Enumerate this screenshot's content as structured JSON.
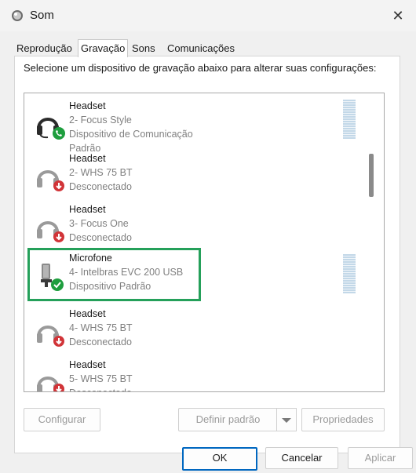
{
  "window": {
    "title": "Som"
  },
  "tabs": [
    {
      "label": "Reprodução"
    },
    {
      "label": "Gravação",
      "active": true
    },
    {
      "label": "Sons"
    },
    {
      "label": "Comunicações"
    }
  ],
  "instruction": "Selecione um dispositivo de gravação abaixo para alterar suas configurações:",
  "devices": [
    {
      "name": "Headset",
      "detail": "2- Focus Style",
      "status": "Dispositivo de Comunicação Padrão",
      "icon": "headset-icon",
      "badge": "phone-badge",
      "meter": true
    },
    {
      "name": "Headset",
      "detail": "2- WHS 75 BT",
      "status": "Desconectado",
      "icon": "headset-icon",
      "badge": "disconnected-badge"
    },
    {
      "name": "Headset",
      "detail": "3- Focus One",
      "status": "Desconectado",
      "icon": "headset-icon",
      "badge": "disconnected-badge"
    },
    {
      "name": "Microfone",
      "detail": "4- Intelbras EVC 200 USB",
      "status": "Dispositivo Padrão",
      "icon": "microphone-icon",
      "badge": "default-check-badge",
      "meter": true,
      "selected": true
    },
    {
      "name": "Headset",
      "detail": "4- WHS 75 BT",
      "status": "Desconectado",
      "icon": "headset-icon",
      "badge": "disconnected-badge"
    },
    {
      "name": "Headset",
      "detail": "5- WHS 75 BT",
      "status": "Desconectado",
      "icon": "headset-icon",
      "badge": "disconnected-badge"
    }
  ],
  "buttons": {
    "configure": "Configurar",
    "set_default": "Definir padrão",
    "properties": "Propriedades",
    "ok": "OK",
    "cancel": "Cancelar",
    "apply": "Aplicar"
  },
  "colors": {
    "selection_border": "#25a05a",
    "default_button_border": "#0067c0",
    "meter": "#c3d8e8",
    "check_badge": "#1e9e3e",
    "disconnect_badge": "#d13438"
  }
}
